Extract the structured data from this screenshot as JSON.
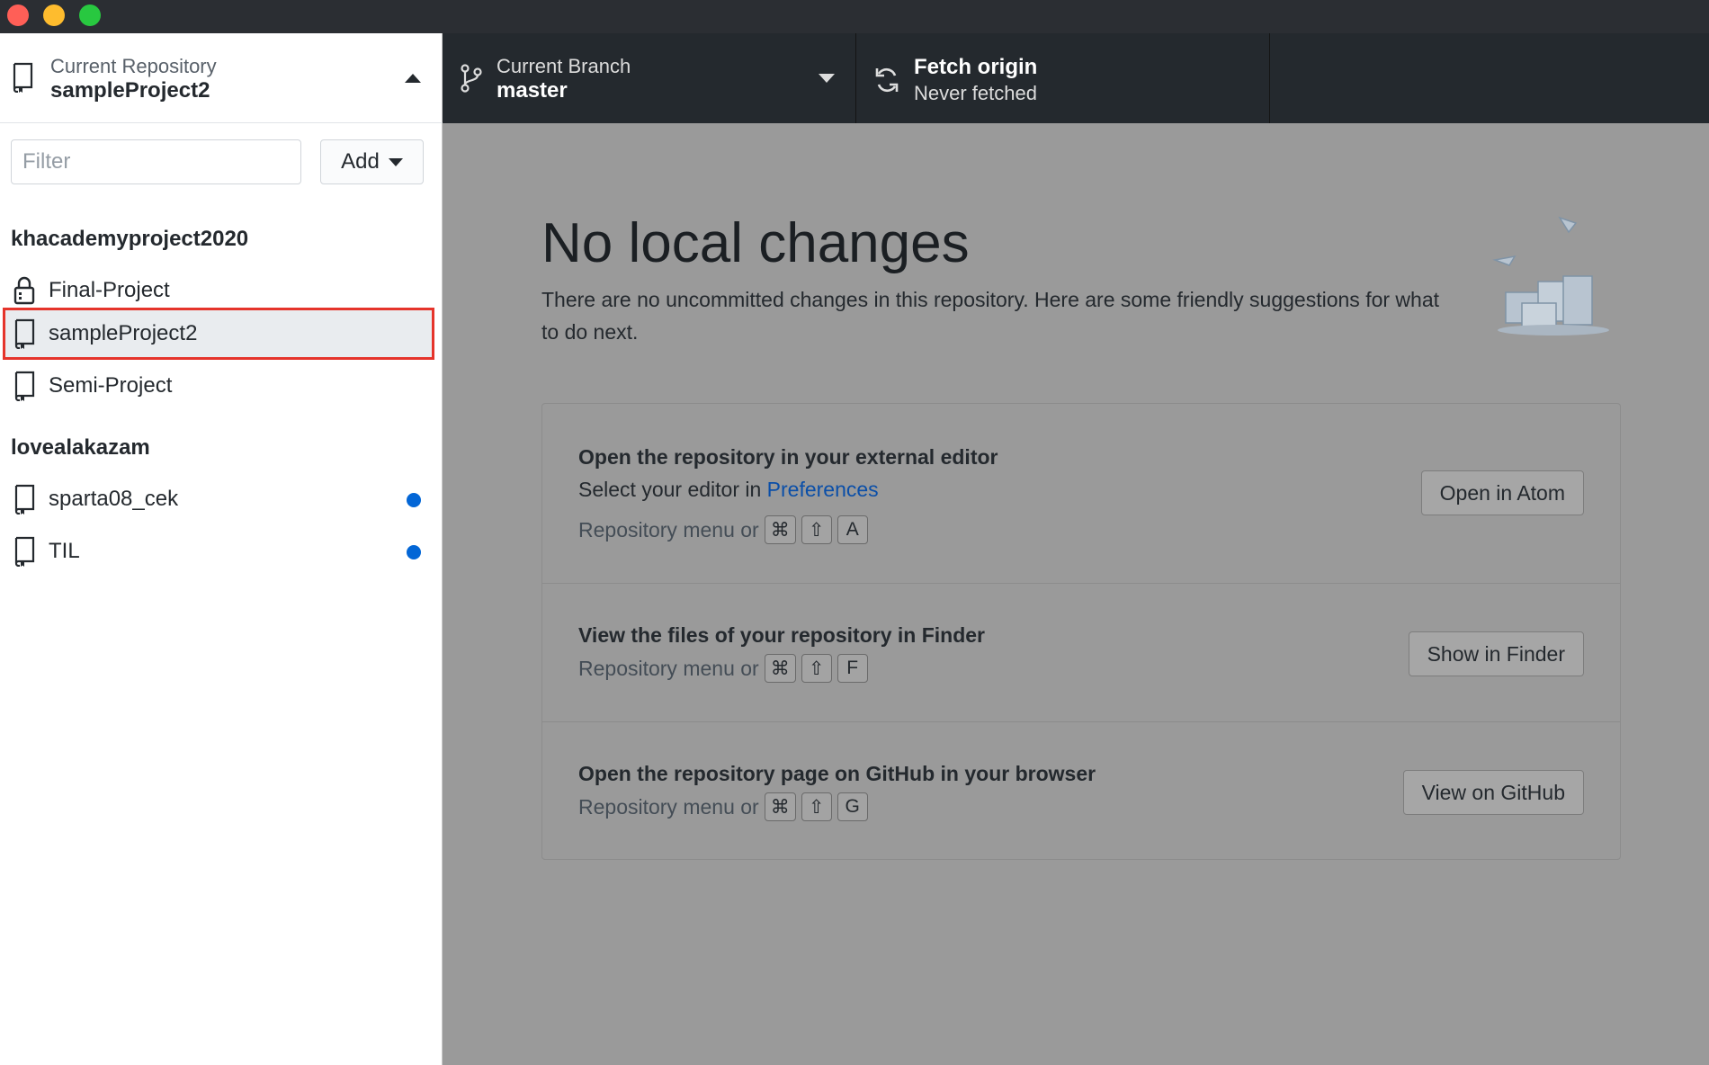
{
  "toolbar": {
    "branch_label": "Current Branch",
    "branch_name": "master",
    "fetch_title": "Fetch origin",
    "fetch_status": "Never fetched"
  },
  "sidebar": {
    "repo_label": "Current Repository",
    "repo_name": "sampleProject2",
    "filter_placeholder": "Filter",
    "add_label": "Add",
    "groups": [
      {
        "title": "khacademyproject2020",
        "items": [
          {
            "label": "Final-Project",
            "icon": "lock-icon"
          },
          {
            "label": "sampleProject2",
            "icon": "repo-icon",
            "selected": true
          },
          {
            "label": "Semi-Project",
            "icon": "repo-icon"
          }
        ]
      },
      {
        "title": "lovealakazam",
        "items": [
          {
            "label": "sparta08_cek",
            "icon": "repo-icon",
            "changes_indicator": true
          },
          {
            "label": "TIL",
            "icon": "repo-icon",
            "changes_indicator": true
          }
        ]
      }
    ]
  },
  "main": {
    "title": "No local changes",
    "description": "There are no uncommitted changes in this repository. Here are some friendly suggestions for what to do next.",
    "suggestions": [
      {
        "title": "Open the repository in your external editor",
        "sub_prefix": "Select your editor in ",
        "sub_link": "Preferences",
        "hint": "Repository menu or",
        "keys": [
          "⌘",
          "⇧",
          "A"
        ],
        "button": "Open in Atom"
      },
      {
        "title": "View the files of your repository in Finder",
        "hint": "Repository menu or",
        "keys": [
          "⌘",
          "⇧",
          "F"
        ],
        "button": "Show in Finder"
      },
      {
        "title": "Open the repository page on GitHub in your browser",
        "hint": "Repository menu or",
        "keys": [
          "⌘",
          "⇧",
          "G"
        ],
        "button": "View on GitHub"
      }
    ]
  },
  "colors": {
    "accent": "#0366d6",
    "selection_outline": "#e5342b",
    "toolbar_bg": "#24292e"
  }
}
